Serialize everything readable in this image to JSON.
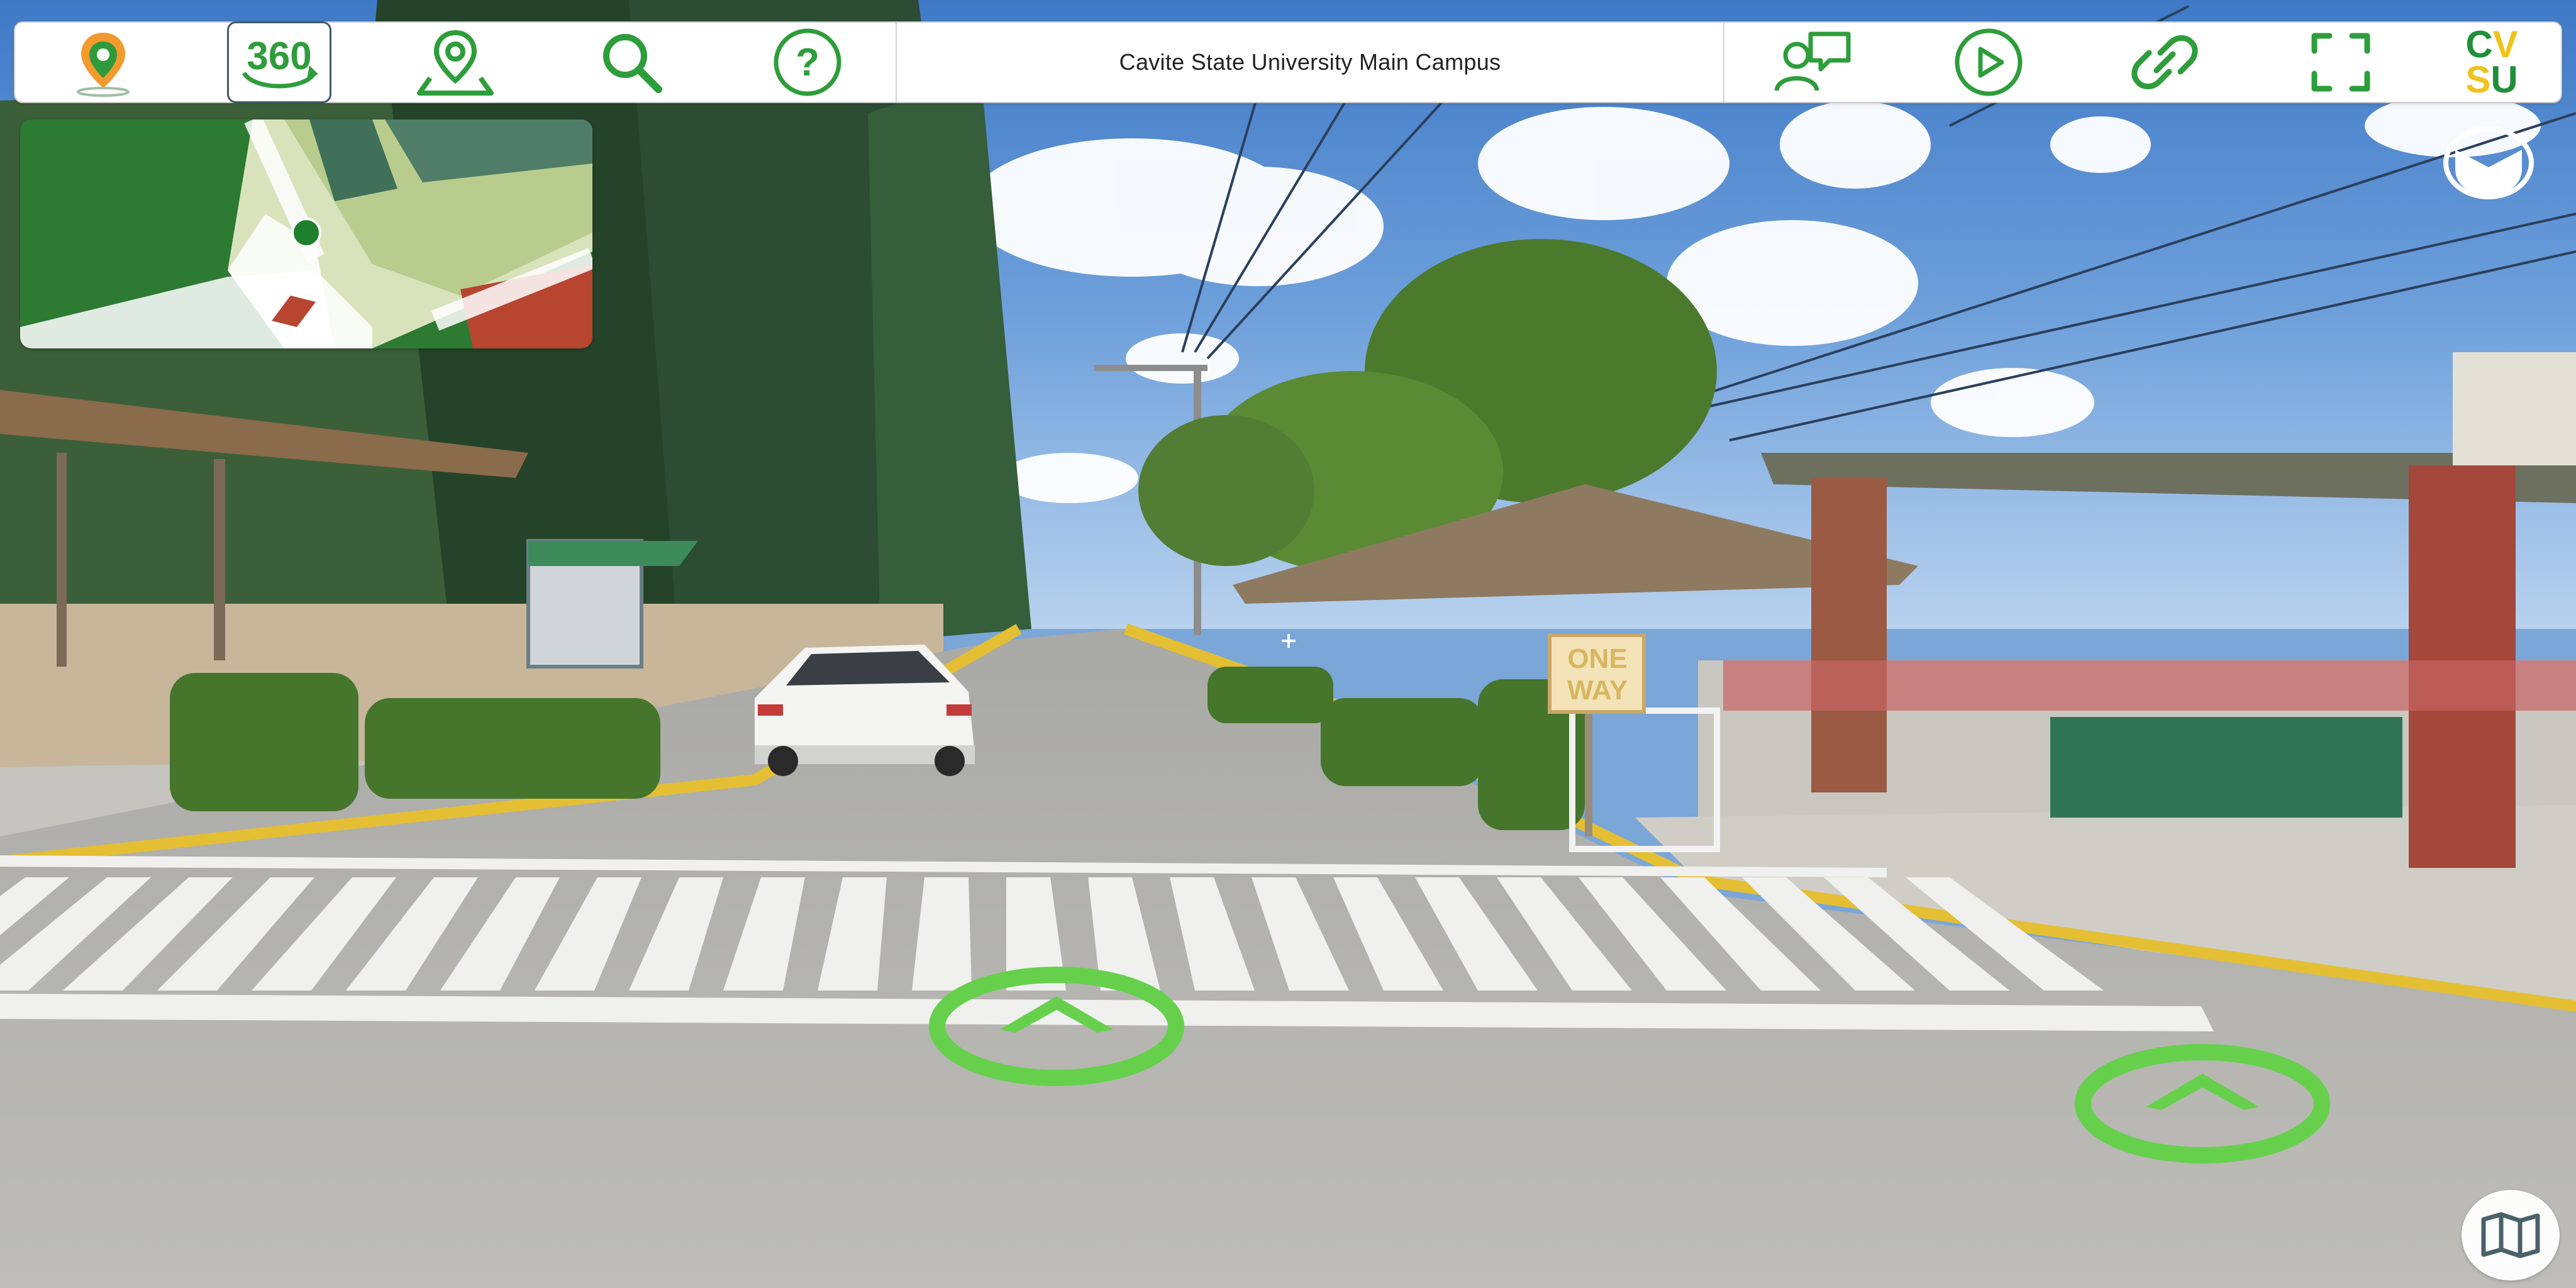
{
  "toolbar": {
    "title": "Cavite State University Main Campus",
    "left_buttons": [
      {
        "name": "location-pin-icon",
        "active": false
      },
      {
        "name": "360-view-icon",
        "label": "360",
        "active": true
      },
      {
        "name": "map-marker-icon",
        "active": false
      },
      {
        "name": "search-icon",
        "active": false
      },
      {
        "name": "help-icon",
        "label": "?",
        "active": false
      }
    ],
    "right_buttons": [
      {
        "name": "chat-user-icon"
      },
      {
        "name": "play-icon"
      },
      {
        "name": "link-icon"
      },
      {
        "name": "fullscreen-icon"
      }
    ],
    "logo": {
      "line1": "CV",
      "line2": "SU",
      "colors": {
        "c": "#1f8f3a",
        "v": "#f1c21b",
        "s": "#f1c21b",
        "u": "#1f8f3a"
      }
    }
  },
  "minimap": {
    "name": "mini-map"
  },
  "scene": {
    "sign_text_1": "ONE",
    "sign_text_2": "WAY"
  },
  "navigation": {
    "hotspots": [
      {
        "name": "forward-arrow-hotspot",
        "direction": "up"
      },
      {
        "name": "right-path-arrow-hotspot",
        "direction": "up"
      }
    ]
  },
  "colors": {
    "accent_green": "#2e9d3b",
    "hotspot_green": "#66d04d",
    "orange": "#f29a2e",
    "toolbar_bg": "#ffffff"
  },
  "icons": {
    "compass": "compass-icon",
    "map": "map-icon",
    "crosshair": "crosshair-icon"
  }
}
